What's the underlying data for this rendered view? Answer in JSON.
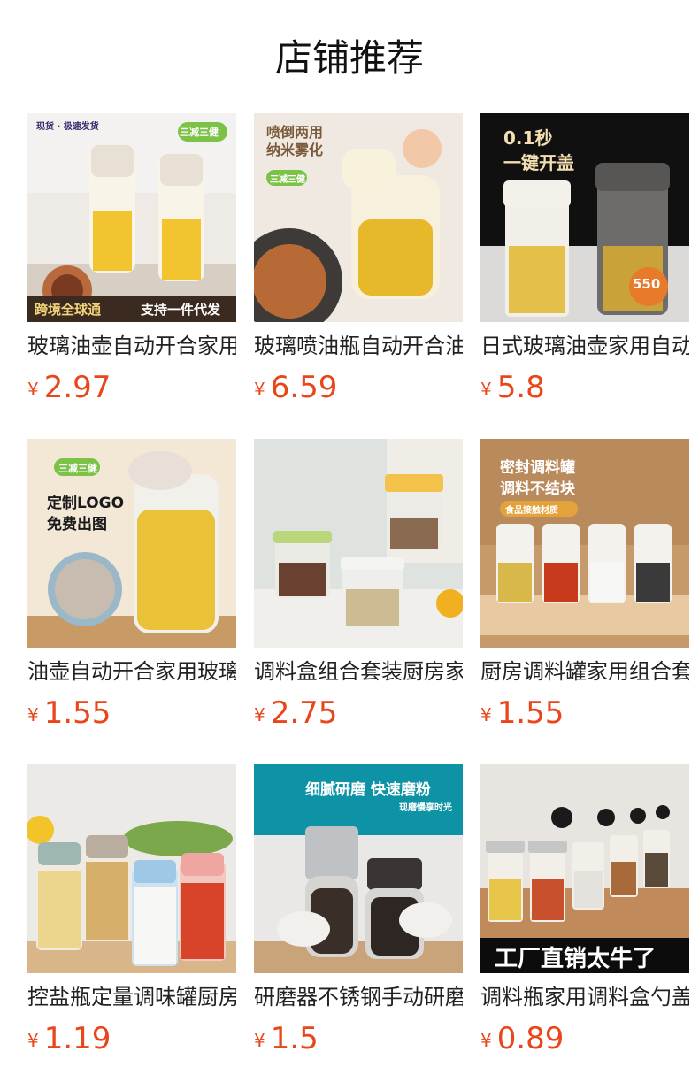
{
  "page": {
    "title": "店铺推荐"
  },
  "colors": {
    "price": "#e8471b",
    "title_text": "#222222",
    "heading": "#111111"
  },
  "products": [
    {
      "title": "玻璃油壶自动开合家用",
      "currency": "¥",
      "price": "2.97",
      "badges": [
        "现货 · 极速发货",
        "三减三健",
        "跨境全球通",
        "支持一件代发"
      ]
    },
    {
      "title": "玻璃喷油瓶自动开合油壶",
      "currency": "¥",
      "price": "6.59",
      "badges": [
        "喷倒两用",
        "纳米雾化",
        "三减三健"
      ]
    },
    {
      "title": "日式玻璃油壶家用自动开合",
      "currency": "¥",
      "price": "5.8",
      "badges": [
        "0.1秒",
        "一键开盖",
        "550"
      ]
    },
    {
      "title": "油壶自动开合家用玻璃",
      "currency": "¥",
      "price": "1.55",
      "badges": [
        "三减三健",
        "定制LOGO",
        "免费出图"
      ]
    },
    {
      "title": "调料盒组合套装厨房家用",
      "currency": "¥",
      "price": "2.75",
      "badges": []
    },
    {
      "title": "厨房调料罐家用组合套装",
      "currency": "¥",
      "price": "1.55",
      "badges": [
        "密封调料罐",
        "调料不结块",
        "食品接触材质"
      ]
    },
    {
      "title": "控盐瓶定量调味罐厨房",
      "currency": "¥",
      "price": "1.19",
      "badges": []
    },
    {
      "title": "研磨器不锈钢手动研磨瓶",
      "currency": "¥",
      "price": "1.5",
      "badges": [
        "细腻研磨 快速磨粉",
        "现磨慢享时光"
      ]
    },
    {
      "title": "调料瓶家用调料盒勺盖一体",
      "currency": "¥",
      "price": "0.89",
      "badges": [
        "工厂直销太牛了"
      ]
    }
  ]
}
